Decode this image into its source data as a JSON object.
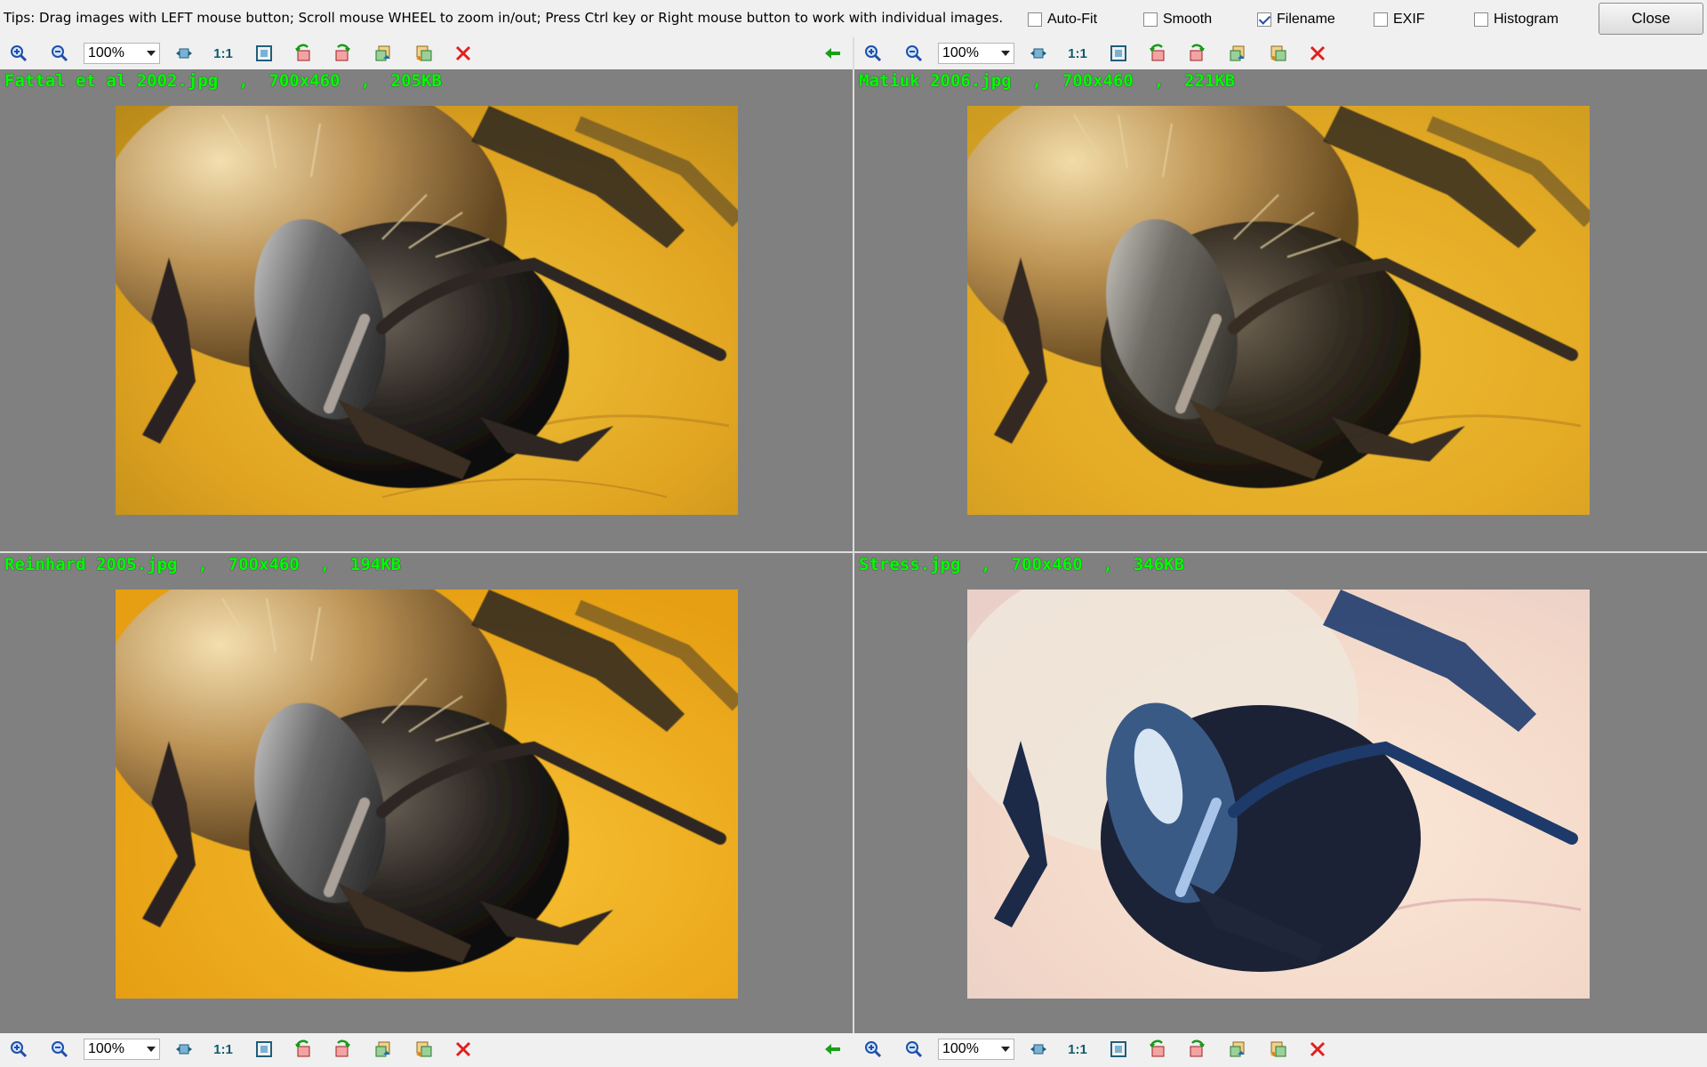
{
  "tips": "Tips: Drag images with LEFT mouse button; Scroll mouse WHEEL to zoom in/out; Press Ctrl key or Right mouse button to work with individual images.",
  "options": [
    {
      "label": "Auto-Fit",
      "checked": false
    },
    {
      "label": "Smooth",
      "checked": false
    },
    {
      "label": "Filename",
      "checked": true
    },
    {
      "label": "EXIF",
      "checked": false
    },
    {
      "label": "Histogram",
      "checked": false
    }
  ],
  "close_label": "Close",
  "toolbar": {
    "zoom_value": "100%",
    "one_to_one": "1:1",
    "icons": [
      "zoom-in-icon",
      "zoom-out-icon",
      "fit-width-icon",
      "fit-window-icon",
      "rotate-left-icon",
      "rotate-right-icon",
      "previous-image-icon",
      "next-image-icon",
      "close-image-icon",
      "sync-arrow-icon"
    ]
  },
  "panes": [
    {
      "label": "Fattal et al 2002.jpg  ,  700x460  ,  205KB",
      "tone": "fattal"
    },
    {
      "label": "Matiuk 2006.jpg  ,  700x460  ,  221KB",
      "tone": "matiuk"
    },
    {
      "label": "Reinhard 2005.jpg  ,  700x460  ,  194KB",
      "tone": "reinhard"
    },
    {
      "label": "Stress.jpg  ,  700x460  ,  346KB",
      "tone": "stress"
    }
  ],
  "colors": {
    "label_text": "#00ff00",
    "pane_bg": "#808080",
    "toolbar_bg": "#f0f0f0",
    "close_icon": "#e02020",
    "arrow_icon": "#18a018"
  }
}
